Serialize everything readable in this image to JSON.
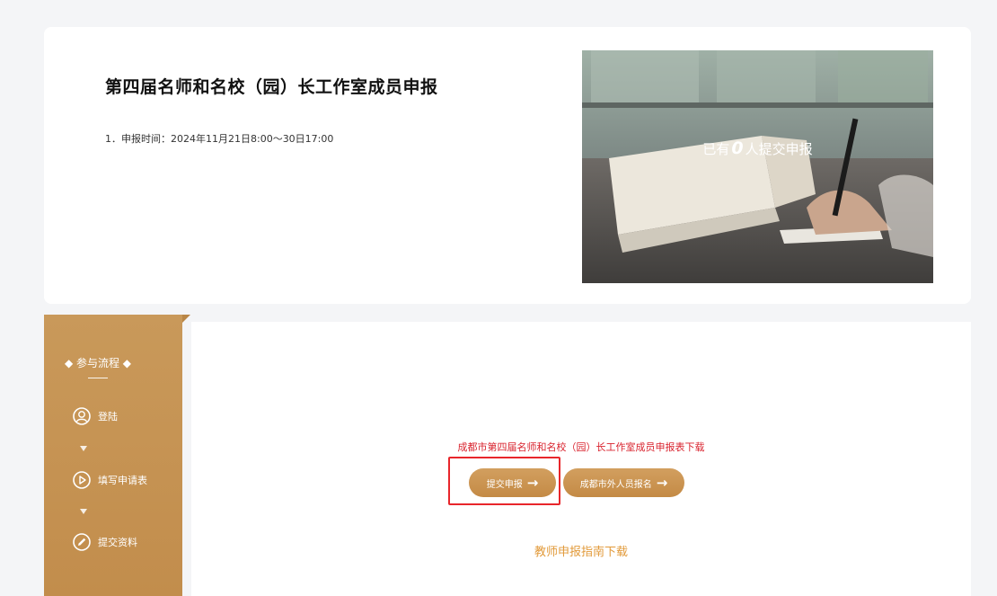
{
  "title": "第四届名师和名校（园）长工作室成员申报",
  "apply_time": "1．申报时间：2024年11月21日8:00～30日17:00",
  "hero": {
    "prefix": "已有",
    "count": "0",
    "suffix": "人提交申报"
  },
  "sidebar": {
    "flow_title": "◆ 参与流程 ◆",
    "steps": [
      {
        "label": "登陆",
        "icon": "user-icon"
      },
      {
        "label": "填写申请表",
        "icon": "play-circle-icon"
      },
      {
        "label": "提交资料",
        "icon": "pen-circle-icon"
      }
    ]
  },
  "main": {
    "download_link": "成都市第四届名师和名校（园）长工作室成员申报表下载",
    "submit_button": "提交申报",
    "outside_button": "成都市外人员报名",
    "arrow": "→",
    "guide_link": "教师申报指南下载"
  },
  "colors": {
    "accent": "#c9995a",
    "link_red": "#d9232e",
    "guide_orange": "#e29a3a",
    "highlight": "#e8262b"
  }
}
